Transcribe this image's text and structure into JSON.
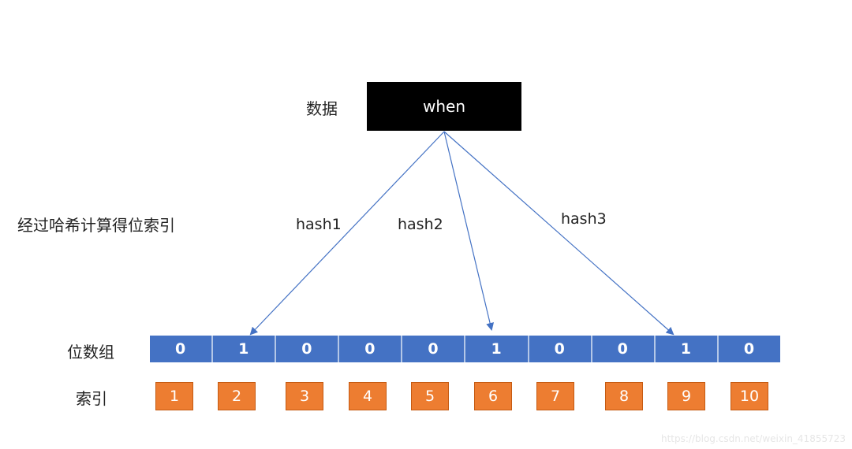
{
  "diagram": {
    "data_label": "数据",
    "data_value": "when",
    "hash_step_label": "经过哈希计算得位索引",
    "hashes": [
      {
        "label": "hash1",
        "target_index": 2
      },
      {
        "label": "hash2",
        "target_index": 6
      },
      {
        "label": "hash3",
        "target_index": 9
      }
    ],
    "bit_array_label": "位数组",
    "bits": [
      "0",
      "1",
      "0",
      "0",
      "0",
      "1",
      "0",
      "0",
      "1",
      "0"
    ],
    "index_label": "索引",
    "indices": [
      "1",
      "2",
      "3",
      "4",
      "5",
      "6",
      "7",
      "8",
      "9",
      "10"
    ],
    "colors": {
      "bit_array": "#4472c4",
      "index_box": "#ed7d31",
      "arrow": "#4472c4",
      "data_box": "#000000"
    }
  },
  "watermark": "https://blog.csdn.net/weixin_41855723"
}
